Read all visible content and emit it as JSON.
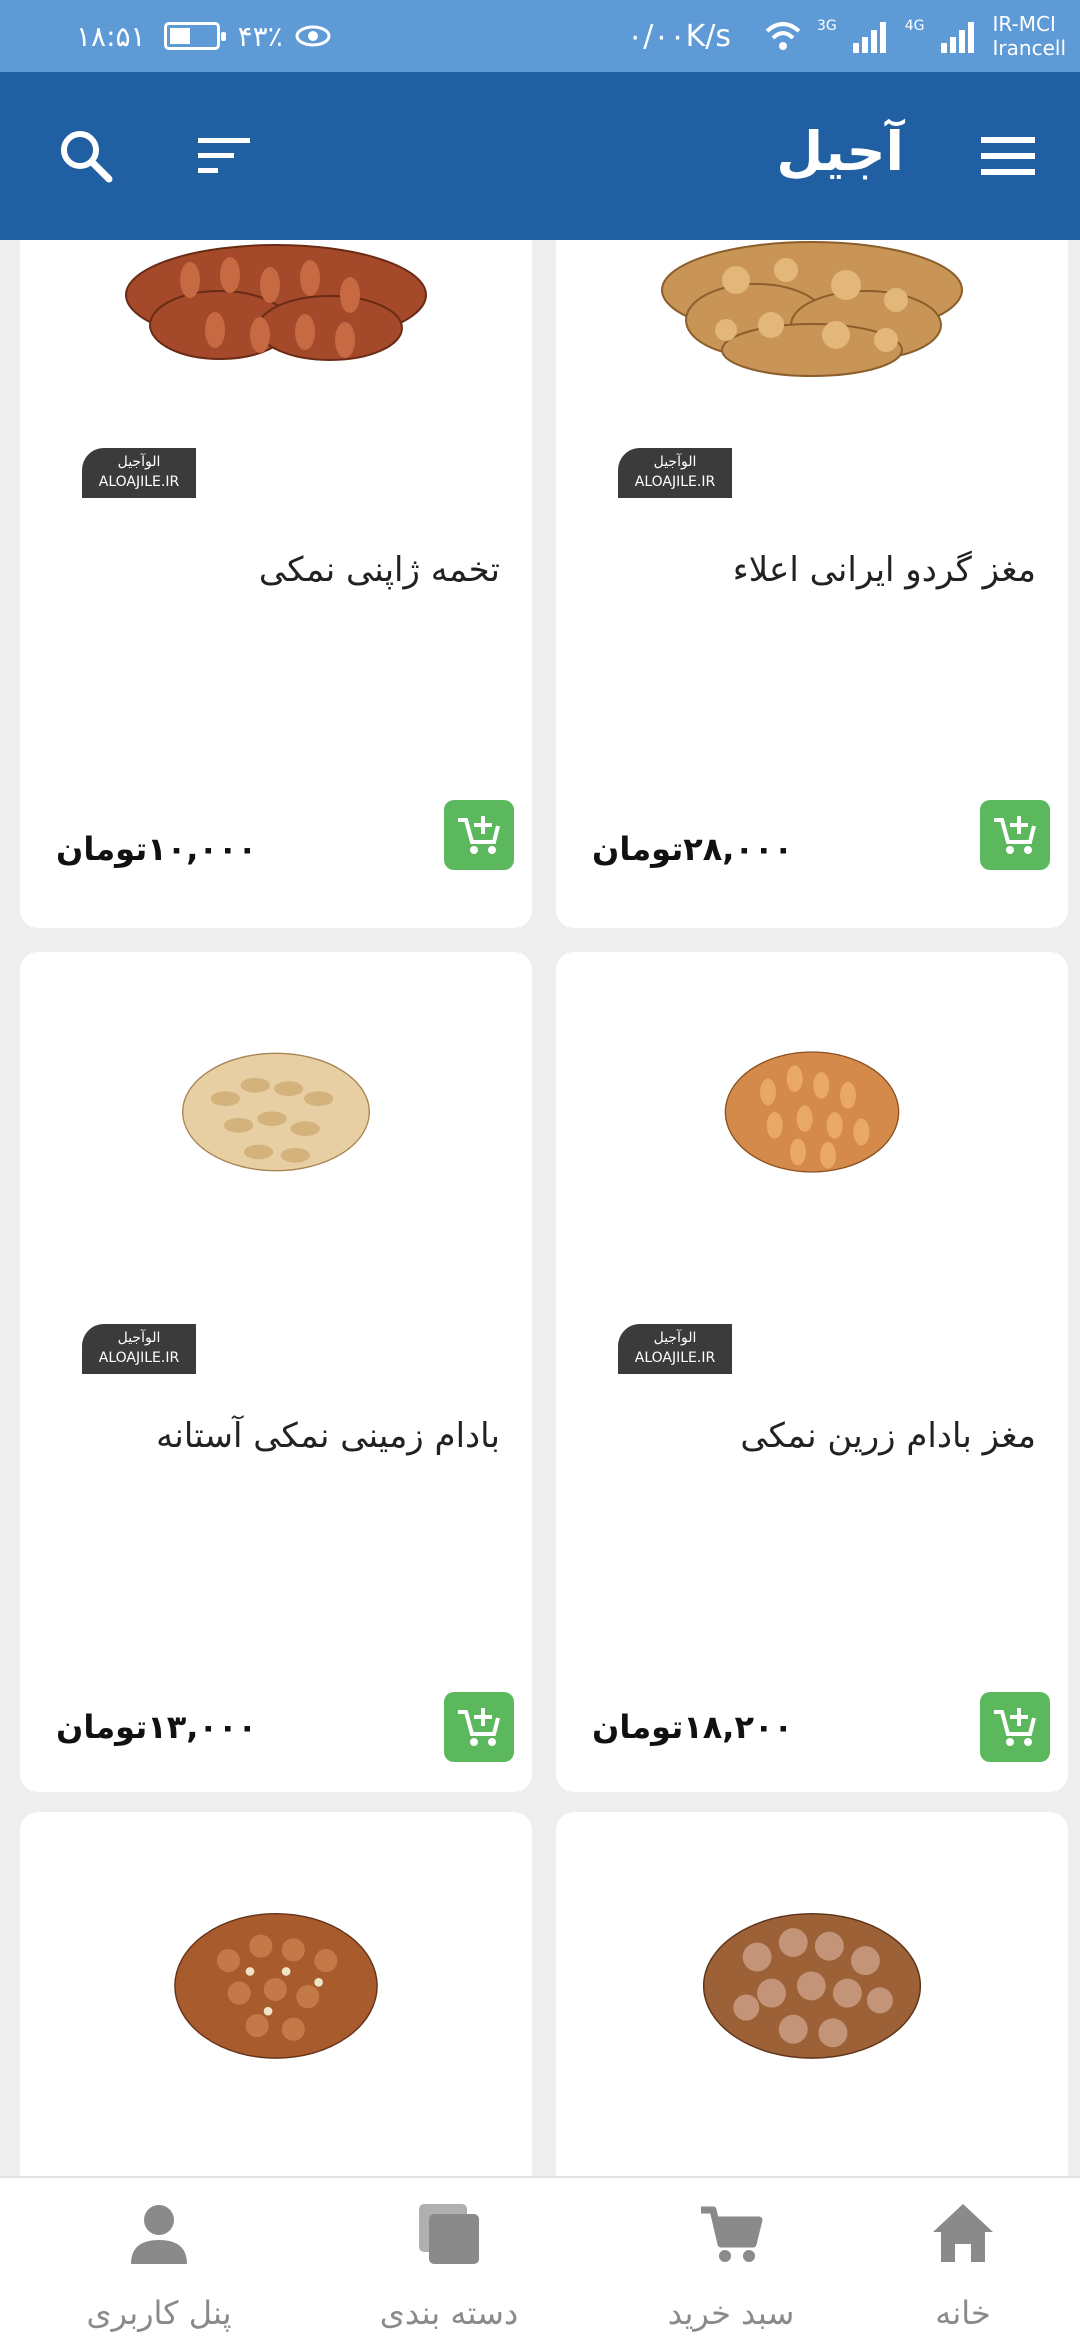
{
  "status_bar": {
    "time": "۱۸:۵۱",
    "battery": "۴۳٪",
    "net_speed": "۰/۰۰K/s",
    "carrier_line1": "IR-MCI",
    "carrier_line2": "Irancell",
    "sim1_type": "3G",
    "sim2_type": "4G"
  },
  "app_bar": {
    "title": "آجیل",
    "menu_icon": "hamburger-menu-icon",
    "filter_icon": "sort-filter-icon",
    "search_icon": "search-icon",
    "color": "#1f5fa2"
  },
  "badge": {
    "line1": "الوآجیل",
    "line2": "ALOAJILE.IR"
  },
  "products": [
    {
      "name": "مغز گردو ایرانی اعلاء",
      "price": "۲۸,۰۰۰تومان"
    },
    {
      "name": "تخمه ژاپنی نمکی",
      "price": "۱۰,۰۰۰تومان"
    },
    {
      "name": "مغز بادام زرین نمکی",
      "price": "۱۸,۲۰۰تومان"
    },
    {
      "name": "بادام زمینی نمکی آستانه",
      "price": "۱۳,۰۰۰تومان"
    },
    {
      "name": "",
      "price": ""
    },
    {
      "name": "",
      "price": ""
    }
  ],
  "bottom_nav": {
    "home": "خانه",
    "cart": "سبد خرید",
    "categories": "دسته بندی",
    "profile": "پنل کاربری"
  },
  "colors": {
    "accent": "#1f5fa2",
    "add_button": "#5cb85c",
    "nav_gray": "#8a8a8a"
  }
}
